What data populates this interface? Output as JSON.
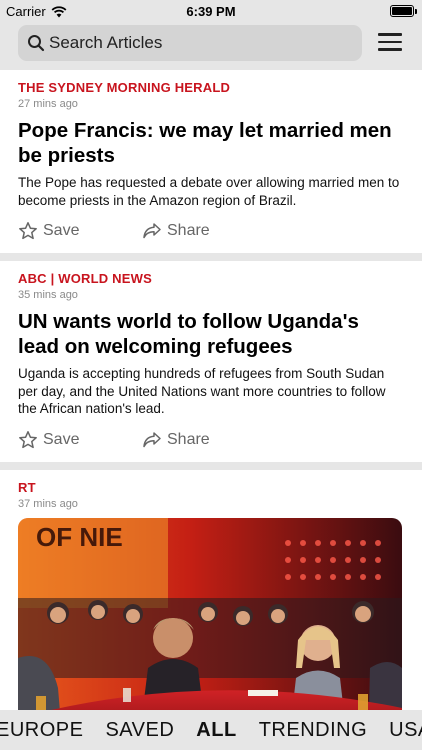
{
  "status_bar": {
    "carrier": "Carrier",
    "time": "6:39 PM"
  },
  "search": {
    "placeholder": "Search Articles"
  },
  "articles": [
    {
      "source": "THE SYDNEY MORNING HERALD",
      "age": "27 mins ago",
      "headline": "Pope Francis: we may let married men be priests",
      "summary": "The Pope has requested a debate over allowing married men to become priests in the Amazon region of Brazil.",
      "save_label": "Save",
      "share_label": "Share"
    },
    {
      "source": "ABC | WORLD NEWS",
      "age": "35 mins ago",
      "headline": "UN wants world to follow Uganda's lead on welcoming refugees",
      "summary": "Uganda is accepting hundreds of refugees from South Sudan per day, and the United Nations want more countries to follow the African nation's lead.",
      "save_label": "Save",
      "share_label": "Share"
    },
    {
      "source": "RT",
      "age": "37 mins ago",
      "image_text": "OF NIE"
    }
  ],
  "tabs": [
    {
      "label": "EUROPE"
    },
    {
      "label": "SAVED"
    },
    {
      "label": "ALL",
      "active": true
    },
    {
      "label": "TRENDING"
    },
    {
      "label": "USA"
    }
  ],
  "colors": {
    "source": "#c8141e",
    "background": "#e6e6e6"
  }
}
